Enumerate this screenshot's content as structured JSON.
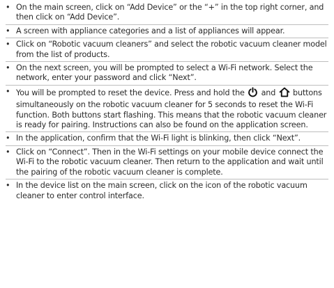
{
  "instructions": {
    "bullet_char": "•",
    "items": [
      {
        "text": "On the main screen, click on “Add Device” or the “+” in the top right corner, and then click on “Add Device”."
      },
      {
        "text": "A screen with appliance categories and a list of appliances will appear."
      },
      {
        "text": "Click on “Robotic vacuum cleaners” and select the robotic vacuum cleaner model from the list of products."
      },
      {
        "text": "On the next screen, you will be prompted to select a Wi-Fi network. Select the network, enter your password and click “Next”."
      },
      {
        "text_before": "You will be prompted to reset the device. Press and hold the",
        "icon_power": "power-icon",
        "text_and": "and",
        "icon_home": "home-icon",
        "text_after": "buttons simultaneously on the robotic vacuum cleaner for 5 seconds to reset the Wi-Fi function. Both buttons start flashing. This means that the robotic vacuum cleaner is ready for pairing. Instructions can also be found on the application screen."
      },
      {
        "text": "In the application, confirm that the Wi-Fi light is blinking, then click “Next”."
      },
      {
        "text": "Click on “Connect”. Then in the Wi-Fi settings on your mobile device connect the Wi-Fi to the robotic vacuum cleaner. Then return to the application and wait until the pairing of the robotic vacuum cleaner is complete."
      },
      {
        "text": "In the device list on the main screen, click on the icon of the robotic vacuum cleaner to enter control interface."
      }
    ]
  }
}
